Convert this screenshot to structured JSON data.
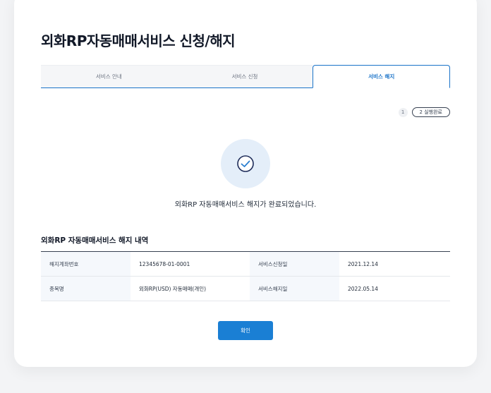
{
  "page": {
    "title": "외화RP자동매매서비스 신청/해지"
  },
  "tabs": [
    {
      "label": "서비스 안내",
      "active": false
    },
    {
      "label": "서비스 신청",
      "active": false
    },
    {
      "label": "서비스 해지",
      "active": true
    }
  ],
  "steps": {
    "step1": "1",
    "step2": "2 실행완료"
  },
  "result": {
    "icon": "check-circle-icon",
    "message": "외화RP 자동매매서비스 해지가 완료되었습니다."
  },
  "details": {
    "title": "외화RP 자동매매서비스 해지 내역",
    "rows": [
      {
        "label1": "해지계좌번호",
        "value1": "12345678-01-0001",
        "label2": "서비스신청일",
        "value2": "2021.12.14"
      },
      {
        "label1": "종목명",
        "value1": "외화RP(USD) 자동매매(개인)",
        "label2": "서비스해지일",
        "value2": "2022.05.14"
      }
    ]
  },
  "actions": {
    "confirm_label": "확인"
  },
  "colors": {
    "accent": "#1a7fd4",
    "icon_bg": "#e4eef9"
  }
}
